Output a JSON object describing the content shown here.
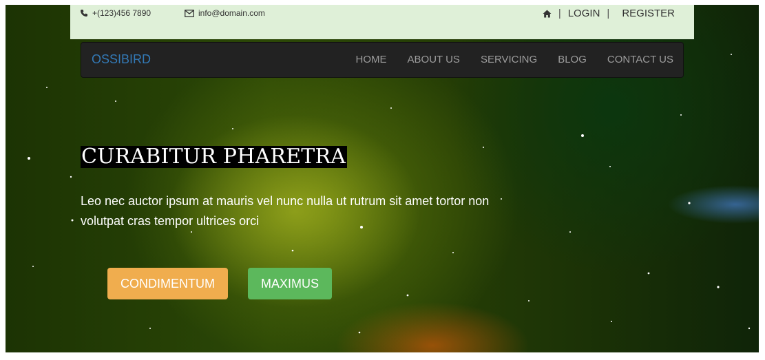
{
  "topbar": {
    "phone": "+(123)456 7890",
    "email": "info@domain.com",
    "login_label": "LOGIN",
    "register_label": "REGISTER",
    "separator": "|",
    "icons": {
      "phone": "phone-icon",
      "email": "envelope-icon",
      "home": "home-icon"
    }
  },
  "navbar": {
    "brand": "OSSIBIRD",
    "items": [
      {
        "label": "HOME"
      },
      {
        "label": "ABOUT US"
      },
      {
        "label": "SERVICING"
      },
      {
        "label": "BLOG"
      },
      {
        "label": "CONTACT US"
      }
    ]
  },
  "hero": {
    "title": "CURABITUR PHARETRA",
    "text": "Leo nec auctor ipsum at mauris vel nunc nulla ut rutrum sit amet tortor non volutpat cras tempor ultrices orci",
    "buttons": [
      {
        "label": "CONDIMENTUM",
        "color": "#f0ad4e"
      },
      {
        "label": "MAXIMUS",
        "color": "#5cb85c"
      }
    ]
  },
  "colors": {
    "topbar_bg": "#dff0d8",
    "navbar_bg": "#222222",
    "brand": "#337ab7",
    "nav_text": "#9d9d9d"
  }
}
